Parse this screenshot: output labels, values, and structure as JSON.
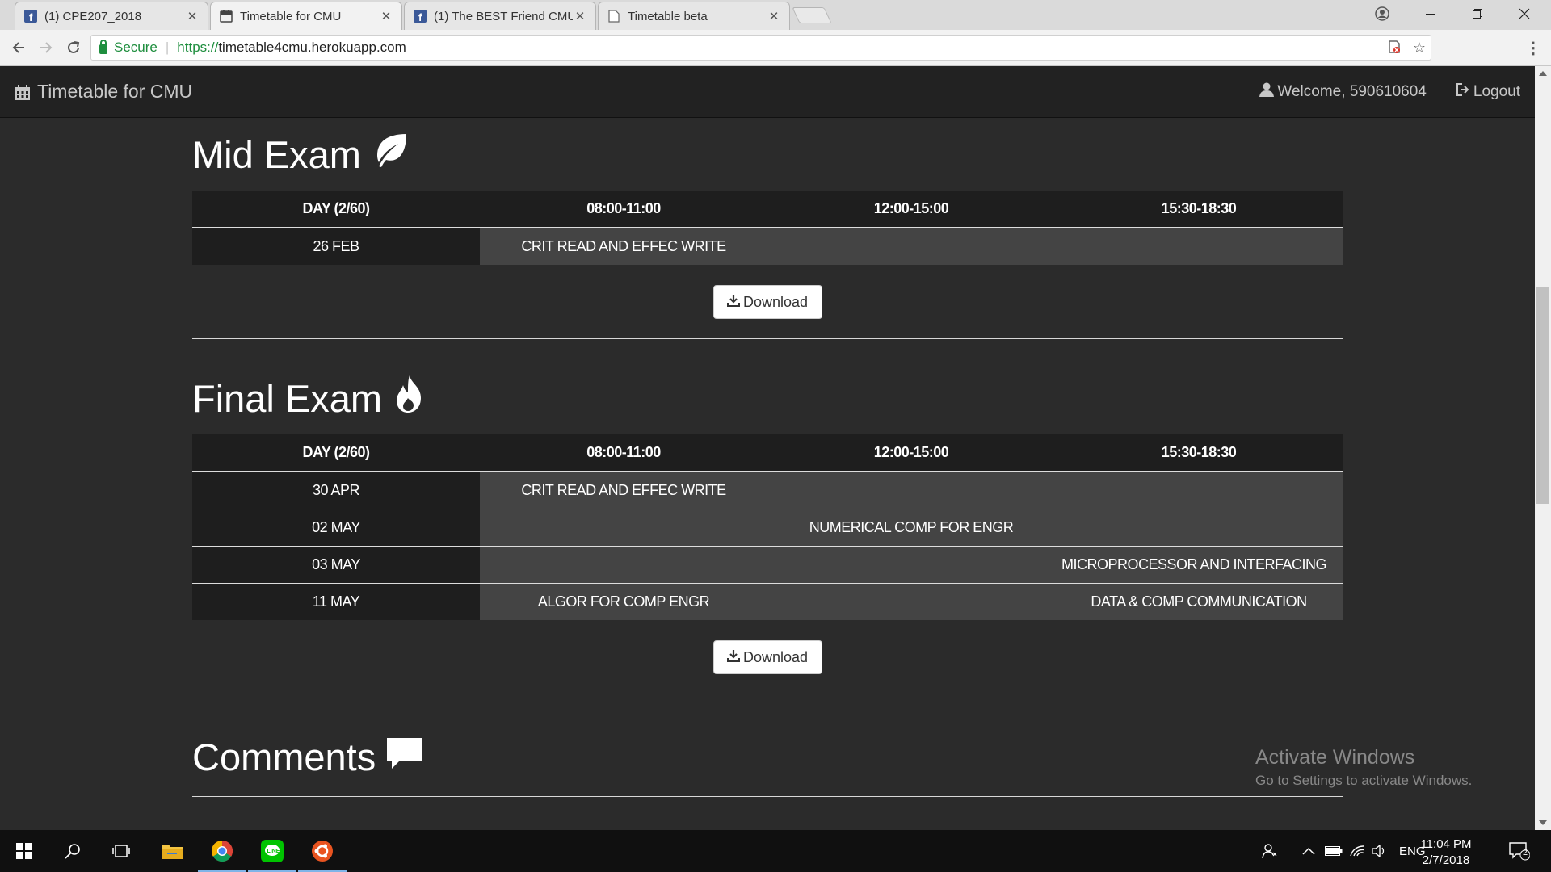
{
  "browser": {
    "tabs": [
      {
        "title": "(1) CPE207_2018",
        "icon": "facebook-icon",
        "active": false
      },
      {
        "title": "Timetable for CMU",
        "icon": "calendar-icon",
        "active": true
      },
      {
        "title": "(1) The BEST Friend CMU",
        "icon": "facebook-icon",
        "active": false
      },
      {
        "title": "Timetable beta",
        "icon": "page-icon",
        "active": false
      }
    ],
    "address": {
      "secure_label": "Secure",
      "url_scheme": "https://",
      "url_host": "timetable4cmu.herokuapp.com"
    }
  },
  "site": {
    "brand": "Timetable for CMU",
    "welcome": "Welcome, 590610604",
    "logout": "Logout"
  },
  "mid_exam": {
    "title": "Mid Exam",
    "headers": [
      "DAY (2/60)",
      "08:00-11:00",
      "12:00-15:00",
      "15:30-18:30"
    ],
    "rows": [
      {
        "day": "26 FEB",
        "slots": [
          "CRIT READ AND EFFEC WRITE",
          "",
          ""
        ]
      }
    ],
    "download": "Download"
  },
  "final_exam": {
    "title": "Final Exam",
    "headers": [
      "DAY (2/60)",
      "08:00-11:00",
      "12:00-15:00",
      "15:30-18:30"
    ],
    "rows": [
      {
        "day": "30 APR",
        "slots": [
          "CRIT READ AND EFFEC WRITE",
          "",
          ""
        ]
      },
      {
        "day": "02 MAY",
        "slots": [
          "",
          "NUMERICAL COMP FOR ENGR",
          ""
        ]
      },
      {
        "day": "03 MAY",
        "slots": [
          "",
          "",
          "MICROPROCESSOR AND INTERFACING"
        ]
      },
      {
        "day": "11 MAY",
        "slots": [
          "ALGOR FOR COMP ENGR",
          "",
          "DATA & COMP COMMUNICATION"
        ]
      }
    ],
    "download": "Download"
  },
  "comments": {
    "title": "Comments"
  },
  "watermark": {
    "line1": "Activate Windows",
    "line2": "Go to Settings to activate Windows."
  },
  "taskbar": {
    "language": "ENG",
    "time": "11:04 PM",
    "date": "2/7/2018",
    "notification_count": "2"
  },
  "colors": {
    "page_bg": "#2b2b2b",
    "navbar_bg": "#222222",
    "header_cell_bg": "#1e1e1e",
    "body_cell_bg": "#444444",
    "secure_green": "#1e8e3e"
  }
}
